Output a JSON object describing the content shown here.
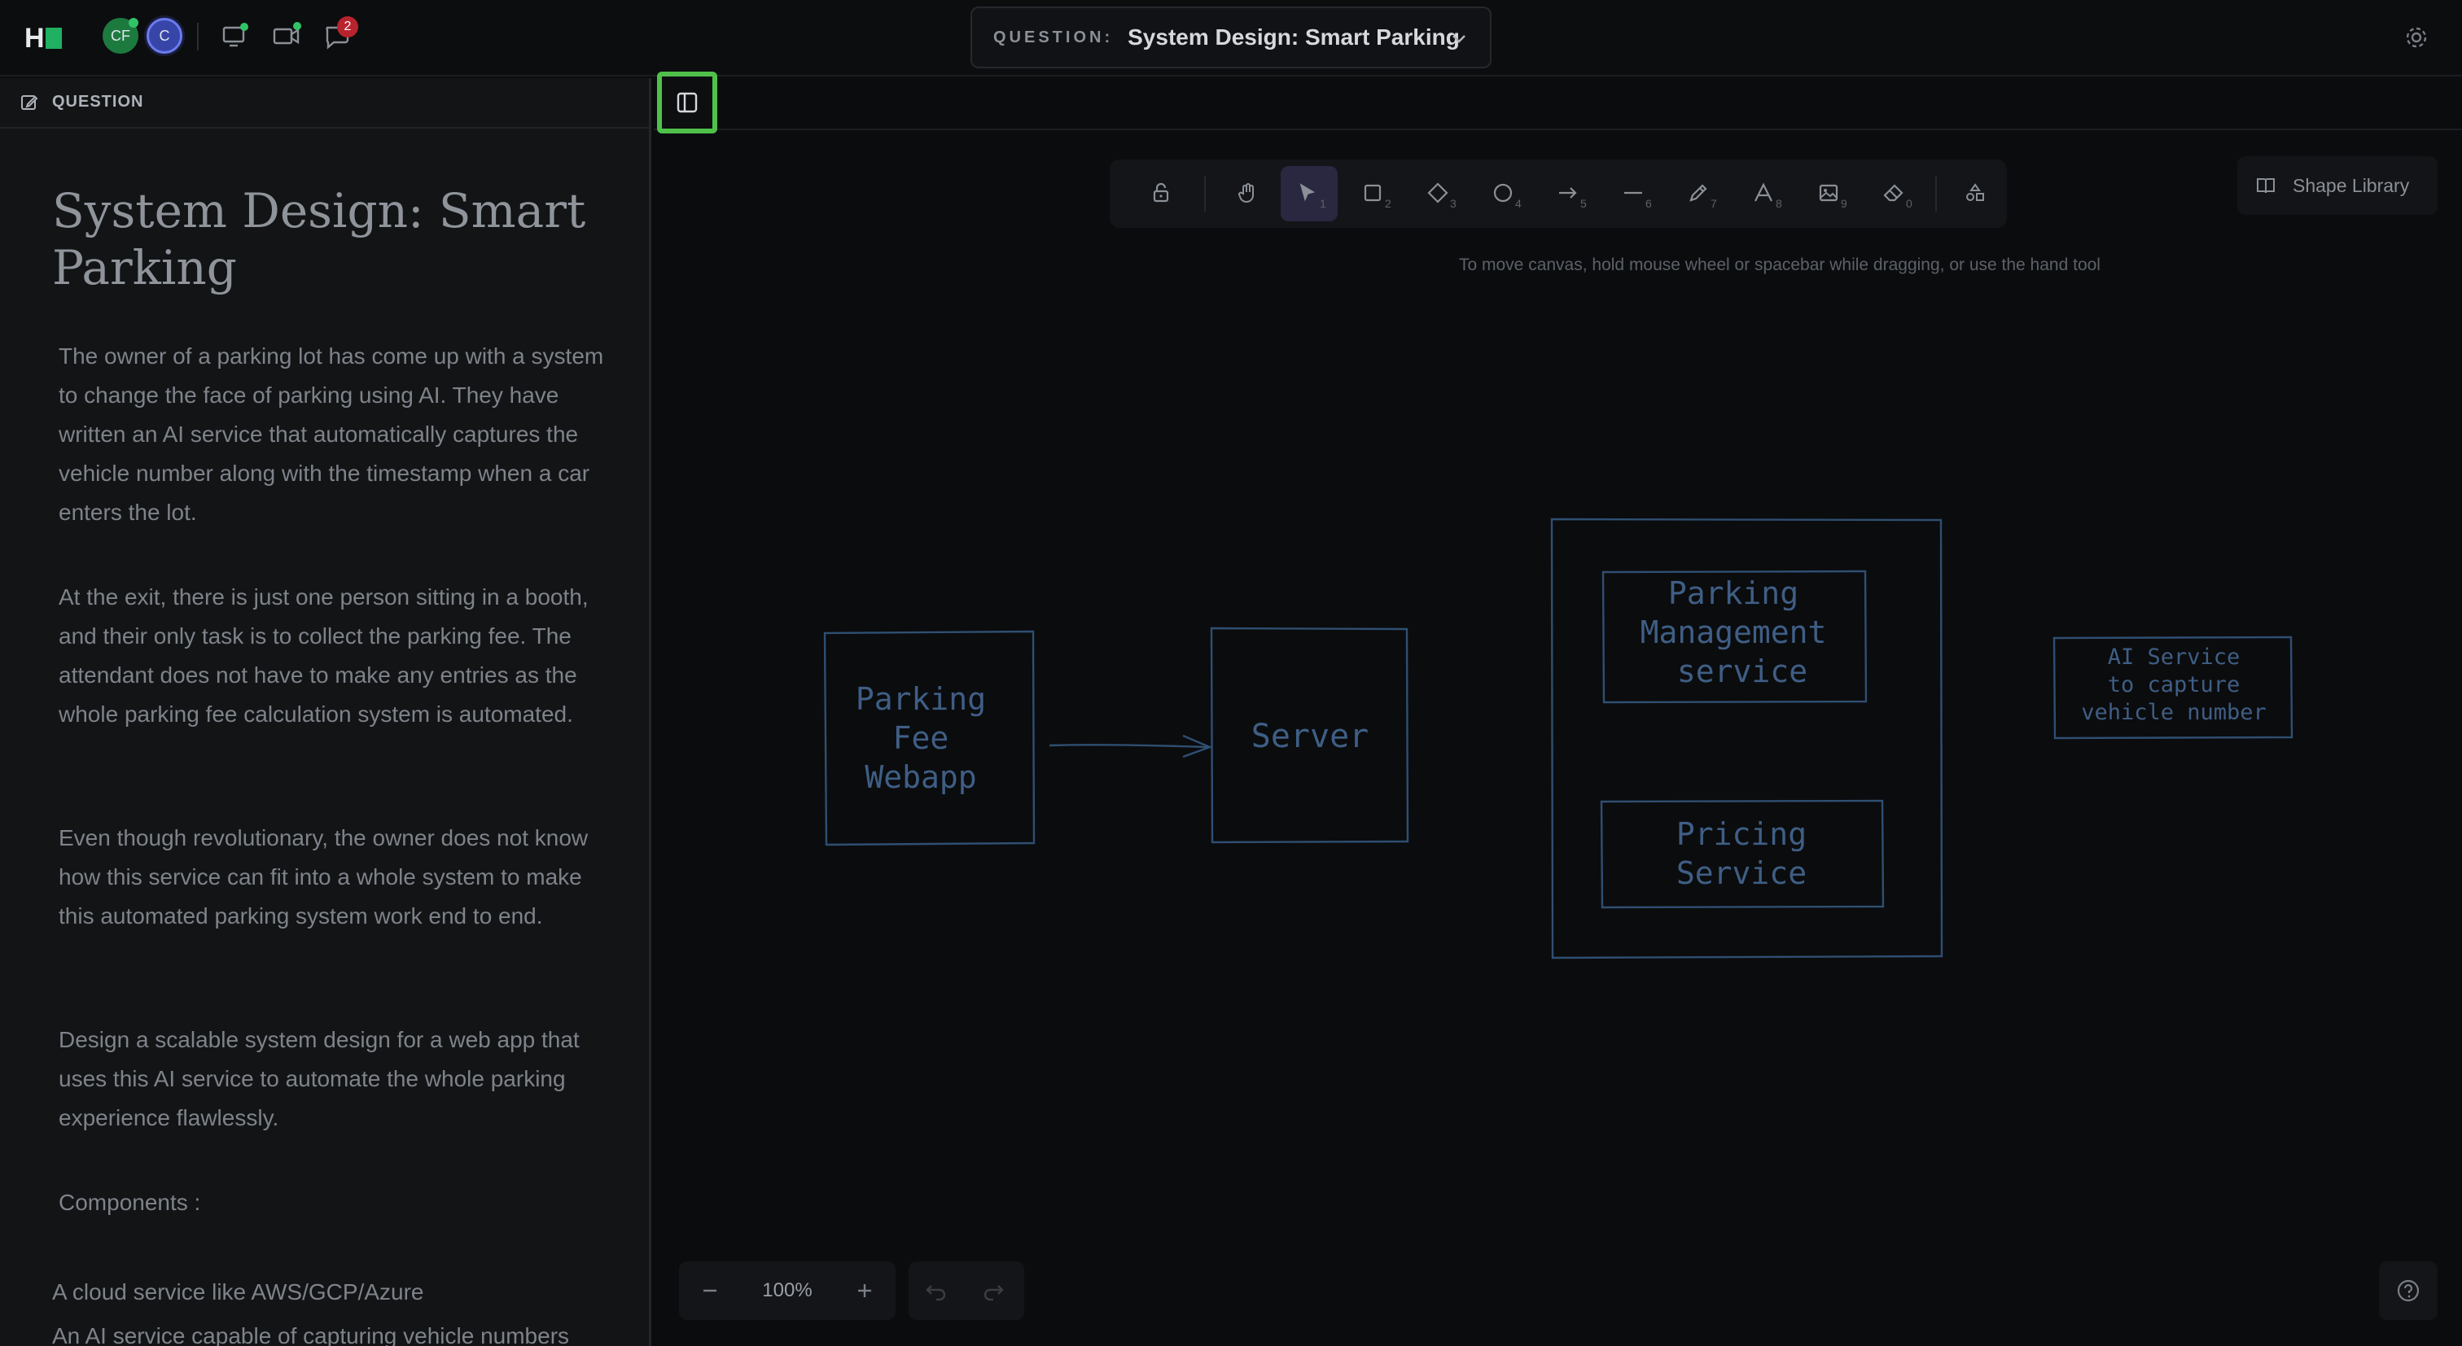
{
  "app": {
    "logo": "logo-mark"
  },
  "participants": [
    {
      "initials": "CF",
      "status": "online"
    },
    {
      "initials": "C",
      "status": "self"
    }
  ],
  "toolbar_top": {
    "notification_count": "2",
    "question_label": "QUESTION:",
    "question_value": "System Design: Smart Parking"
  },
  "panel": {
    "header": "QUESTION",
    "title": "System Design: Smart Parking",
    "paragraphs": [
      "The owner of a parking lot has come up with a system to change the face of parking using AI.  They have written an AI service that automatically captures the vehicle number along with the timestamp when a car enters the lot.",
      "At the exit, there is just one person sitting in a booth, and their only task is to collect the parking fee.  The attendant does not have to make any entries as the whole parking fee calculation system is automated.",
      "Even though revolutionary, the owner does not know how this service can fit into a whole system to make this automated parking system work end to end.",
      "Design a scalable system design for a web app that uses this AI service to automate the whole parking experience flawlessly.",
      "Components :"
    ],
    "components": [
      "A cloud service like AWS/GCP/Azure",
      "An AI service capable of capturing vehicle numbers"
    ]
  },
  "canvas": {
    "tools": [
      {
        "name": "lock",
        "key": ""
      },
      {
        "name": "hand",
        "key": ""
      },
      {
        "name": "select",
        "key": "1"
      },
      {
        "name": "rectangle",
        "key": "2"
      },
      {
        "name": "diamond",
        "key": "3"
      },
      {
        "name": "ellipse",
        "key": "4"
      },
      {
        "name": "arrow",
        "key": "5"
      },
      {
        "name": "line",
        "key": "6"
      },
      {
        "name": "draw",
        "key": "7"
      },
      {
        "name": "text",
        "key": "8"
      },
      {
        "name": "image",
        "key": "9"
      },
      {
        "name": "eraser",
        "key": "0"
      },
      {
        "name": "more-shapes",
        "key": ""
      }
    ],
    "active_tool": "select",
    "hint": "To move canvas, hold mouse wheel or spacebar while dragging, or use the hand tool",
    "shape_library": "Shape Library",
    "zoom": "100%",
    "diagram": {
      "webapp": [
        "Parking",
        "Fee",
        "Webapp"
      ],
      "server": [
        "Server"
      ],
      "parking_mgmt": [
        "Parking",
        "Management",
        "service"
      ],
      "pricing": [
        "Pricing",
        "Service"
      ],
      "ai_service": [
        "AI Service",
        "to capture",
        "vehicle number"
      ]
    }
  },
  "colors": {
    "accent_highlight": "#4fc14a",
    "diagram_stroke": "#2f4f72",
    "badge": "#b9232e",
    "online": "#31c467"
  }
}
